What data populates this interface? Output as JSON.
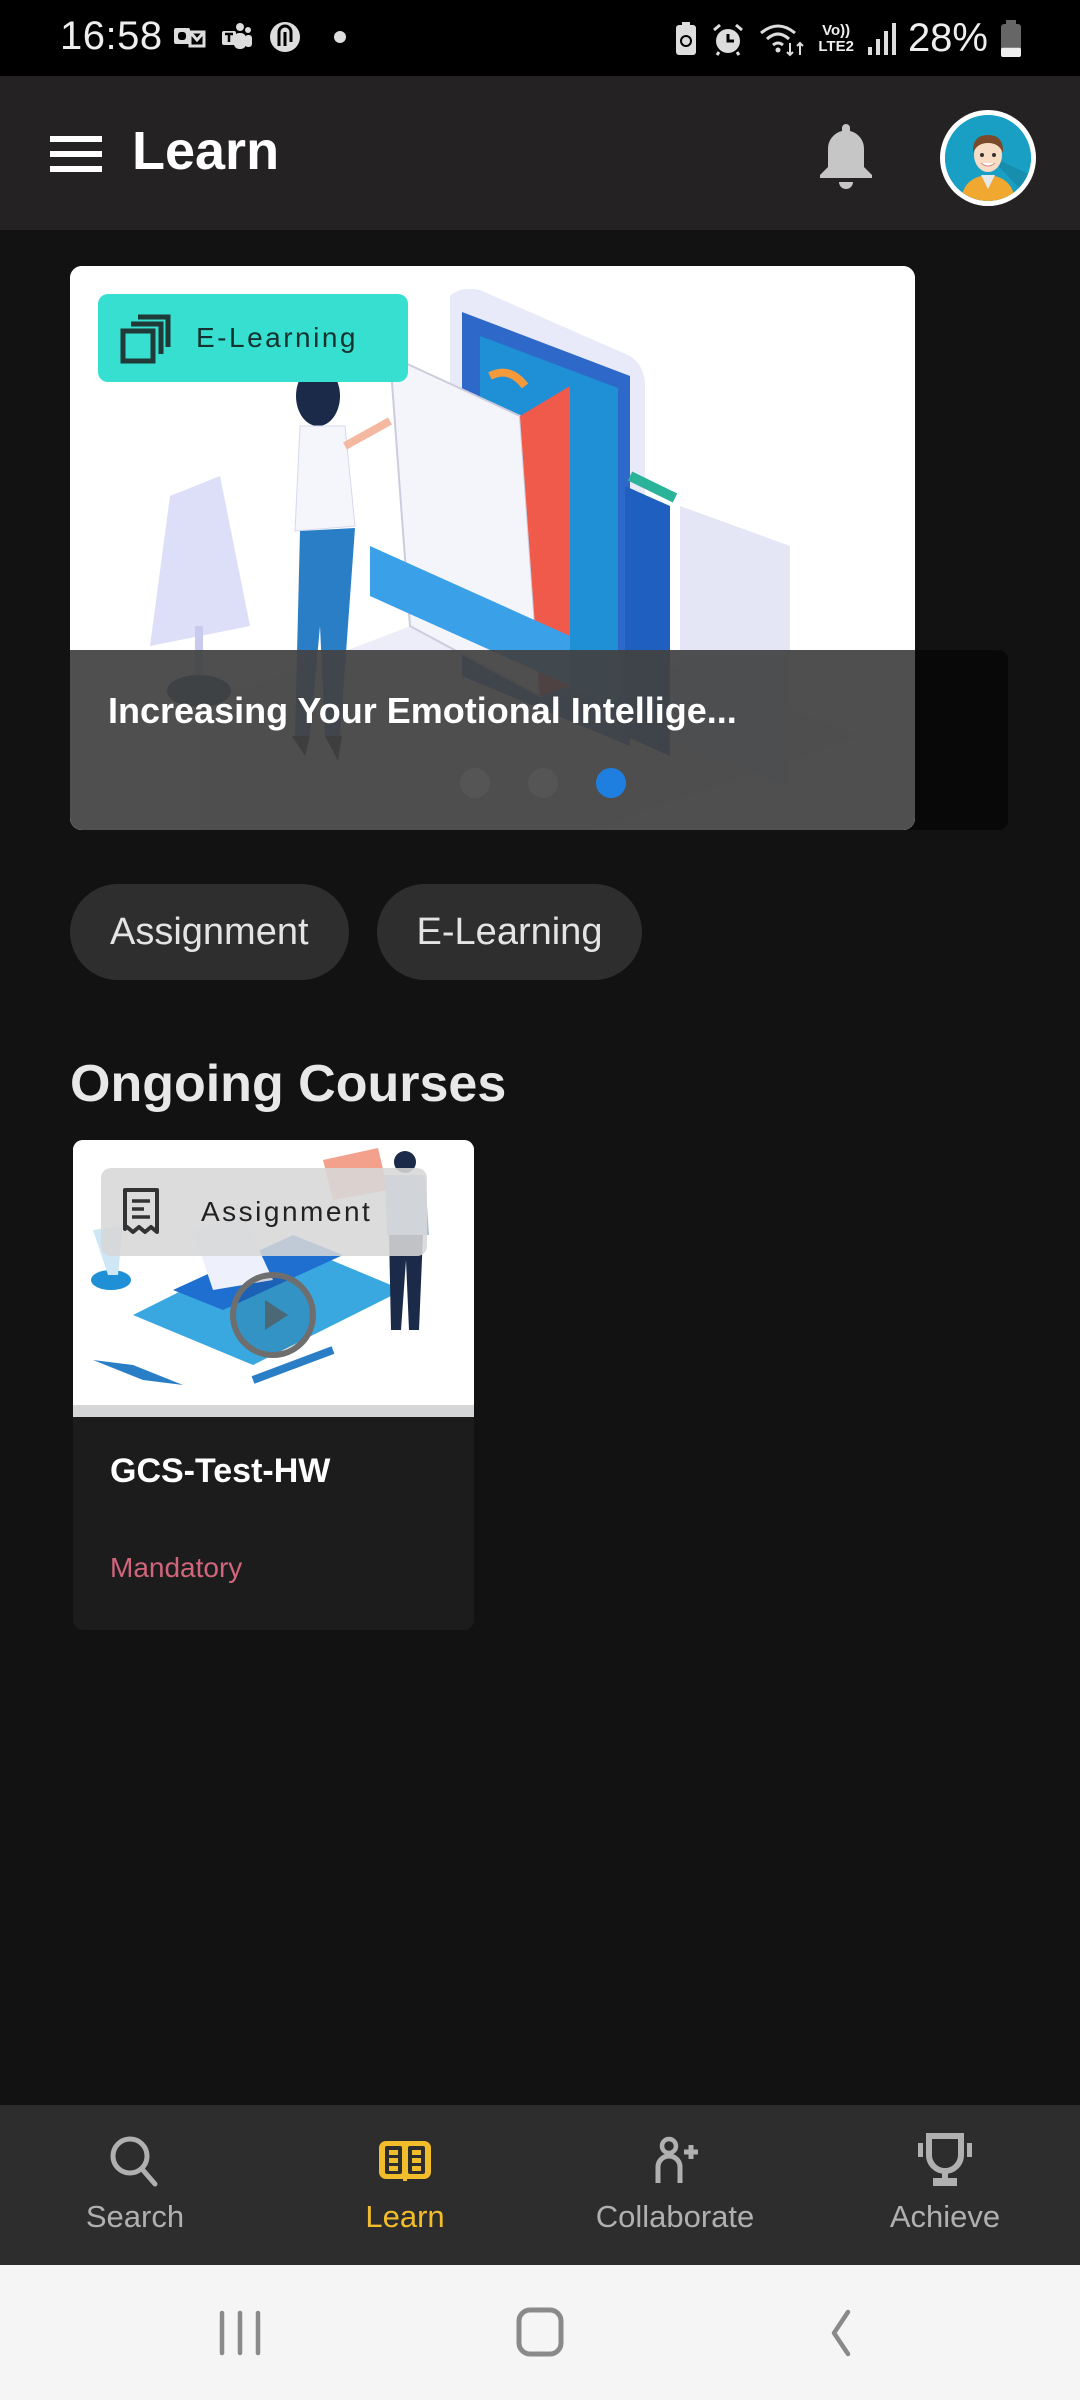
{
  "status_bar": {
    "time": "16:58",
    "notification_icons": [
      "outlook-icon",
      "teams-icon",
      "app-icon",
      "more-dot"
    ],
    "system_icons": [
      "battery-saver-icon",
      "alarm-icon",
      "wifi-icon",
      "volte-lte2-icon",
      "signal-icon"
    ],
    "volte_label": "Vo))",
    "lte_label": "LTE2",
    "battery_percent": "28%",
    "battery_level": 0.28
  },
  "app_bar": {
    "title": "Learn",
    "menu_icon": "hamburger-menu-icon",
    "notification_icon": "bell-icon",
    "avatar": "user-avatar"
  },
  "carousel": {
    "badge_label": "E-Learning",
    "badge_icon": "stacked-pages-icon",
    "title": "Increasing Your Emotional Intellige...",
    "page_count": 3,
    "active_index": 2,
    "colors": {
      "badge_bg": "#36dfcf",
      "active_dot": "#1e7fe0"
    }
  },
  "filters": {
    "chips": [
      {
        "label": "Assignment"
      },
      {
        "label": "E-Learning"
      }
    ]
  },
  "ongoing": {
    "heading": "Ongoing Courses",
    "courses": [
      {
        "badge_label": "Assignment",
        "badge_icon": "receipt-icon",
        "title": "GCS-Test-HW",
        "tag": "Mandatory",
        "tag_color": "#d0657b"
      }
    ]
  },
  "bottom_nav": {
    "active": "Learn",
    "active_color": "#f2bd2a",
    "items": [
      {
        "label": "Search",
        "icon": "search-icon"
      },
      {
        "label": "Learn",
        "icon": "book-icon"
      },
      {
        "label": "Collaborate",
        "icon": "add-person-icon"
      },
      {
        "label": "Achieve",
        "icon": "trophy-icon"
      }
    ]
  },
  "system_nav": {
    "buttons": [
      "recent-apps",
      "home",
      "back"
    ]
  }
}
